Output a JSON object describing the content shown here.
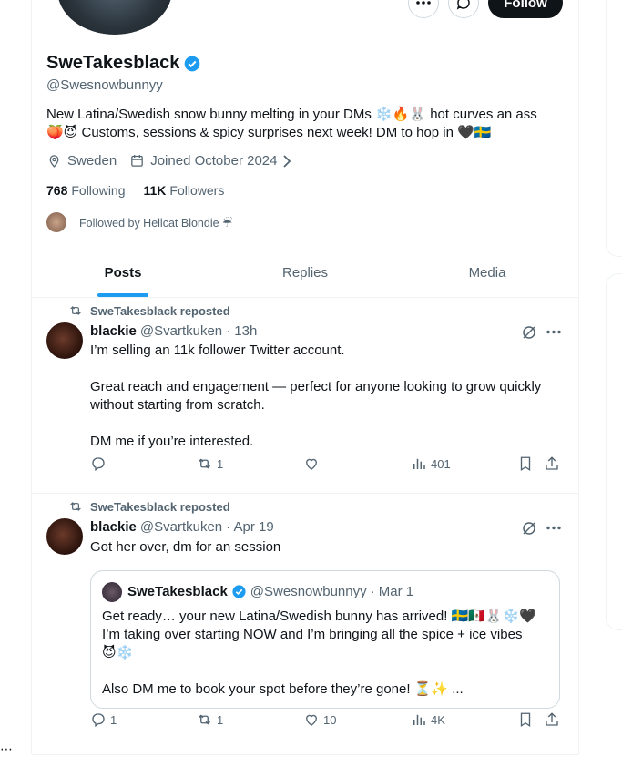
{
  "profile": {
    "name": "SweTakesblack",
    "handle": "@Swesnowbunnyy",
    "bio": "New Latina/Swedish snow bunny melting in your DMs ❄️🔥🐰 hot curves an ass\n🍑😈 Customs, sessions & spicy surprises next week! DM to hop in 🖤🇸🇪",
    "location": "Sweden",
    "joined": "Joined October 2024",
    "following_count": "768",
    "following_label": "Following",
    "followers_count": "11K",
    "followers_label": "Followers",
    "followed_by": "Followed by Hellcat Blondie ☔",
    "follow_label": "Follow"
  },
  "tabs": [
    "Posts",
    "Replies",
    "Media"
  ],
  "posts": [
    {
      "repost_label": "SweTakesblack reposted",
      "author_name": "blackie",
      "author_handle": "@Svartkuken",
      "time": "· 13h",
      "text": "I’m selling an 11k follower Twitter account.\n\nGreat reach and engagement — perfect for anyone looking to grow quickly\nwithout starting from scratch.\n\nDM me if you’re interested.",
      "replies": "",
      "reposts": "1",
      "likes": "",
      "views": "401"
    },
    {
      "repost_label": "SweTakesblack reposted",
      "author_name": "blackie",
      "author_handle": "@Svartkuken",
      "time": "· Apr 19",
      "text": "Got her over, dm for an session",
      "quote": {
        "name": "SweTakesblack",
        "handle": "@Swesnowbunnyy",
        "time": "· Mar 1",
        "text": "Get ready… your new Latina/Swedish bunny has arrived! 🇸🇪🇲🇽🐰❄️🖤\nI’m taking over starting NOW and I’m bringing all the spice + ice vibes\n😈❄️\n\nAlso DM me to book your spot before they’re gone! ⏳✨ ..."
      },
      "replies": "1",
      "reposts": "1",
      "likes": "10",
      "views": "4K"
    }
  ],
  "colors": {
    "accent": "#1d9bf0",
    "muted": "#536471",
    "text": "#0f1419",
    "border": "#eff3f4"
  }
}
